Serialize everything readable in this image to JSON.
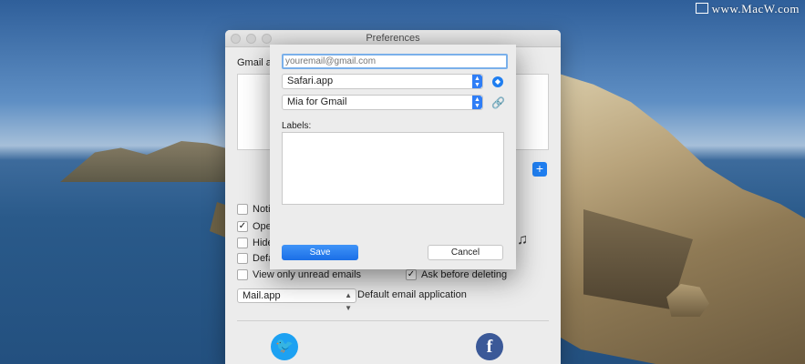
{
  "watermark": "www.MacW.com",
  "prefs_window": {
    "title": "Preferences",
    "gmail_accounts_label": "Gmail ac",
    "add_button_label": "+",
    "options": [
      {
        "label": "Notifi",
        "checked": false
      },
      {
        "label": "Open",
        "checked": true
      },
      {
        "label": "Hide",
        "checked": false
      },
      {
        "label": "Defau",
        "checked": false
      },
      {
        "label": "View only unread emails",
        "checked": false
      }
    ],
    "ask_before_deleting": {
      "label": "Ask before deleting",
      "checked": true
    },
    "email_app_select": "Mail.app",
    "default_email_label": "Default email application",
    "social": {
      "twitter": "🐦",
      "facebook": "f"
    }
  },
  "sheet": {
    "email_placeholder": "youremail@gmail.com",
    "browser_select": "Safari.app",
    "client_select": "Mia for Gmail",
    "labels_title": "Labels:",
    "save_label": "Save",
    "cancel_label": "Cancel"
  },
  "colors": {
    "accent": "#1f7ef0",
    "twitter": "#1da1f2",
    "facebook": "#3b5998"
  }
}
